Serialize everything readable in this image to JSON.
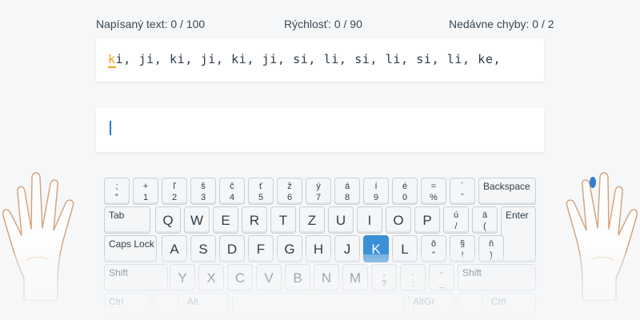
{
  "stats": {
    "typed": "Napísaný text: 0 / 100",
    "speed": "Rýchlosť: 0 / 90",
    "errors": "Nedávne chyby: 0 / 2"
  },
  "exercise": {
    "current_char": "k",
    "remaining_text": "i, ji, ki, ji, ki, ji, si, li, si, li, si, li, ke,"
  },
  "input": {
    "value": ""
  },
  "keyboard": {
    "rows": [
      [
        {
          "u": ";",
          "l": "°"
        },
        {
          "u": "+",
          "l": "1"
        },
        {
          "u": "ľ",
          "l": "2"
        },
        {
          "u": "š",
          "l": "3"
        },
        {
          "u": "č",
          "l": "4"
        },
        {
          "u": "ť",
          "l": "5"
        },
        {
          "u": "ž",
          "l": "6"
        },
        {
          "u": "ý",
          "l": "7"
        },
        {
          "u": "á",
          "l": "8"
        },
        {
          "u": "í",
          "l": "9"
        },
        {
          "u": "é",
          "l": "0"
        },
        {
          "u": "=",
          "l": "%"
        },
        {
          "u": "´",
          "l": "ˇ"
        },
        {
          "w": "Backspace"
        }
      ],
      [
        {
          "w": "Tab"
        },
        {
          "c": "Q"
        },
        {
          "c": "W"
        },
        {
          "c": "E"
        },
        {
          "c": "R"
        },
        {
          "c": "T"
        },
        {
          "c": "Z"
        },
        {
          "c": "U"
        },
        {
          "c": "I"
        },
        {
          "c": "O"
        },
        {
          "c": "P"
        },
        {
          "u": "ú",
          "l": "/"
        },
        {
          "u": "ä",
          "l": "("
        },
        {
          "w": "Enter"
        }
      ],
      [
        {
          "w": "Caps Lock"
        },
        {
          "c": "A"
        },
        {
          "c": "S"
        },
        {
          "c": "D"
        },
        {
          "c": "F"
        },
        {
          "c": "G"
        },
        {
          "c": "H"
        },
        {
          "c": "J"
        },
        {
          "c": "K"
        },
        {
          "c": "L"
        },
        {
          "u": "ô",
          "l": "\""
        },
        {
          "u": "§",
          "l": "!"
        },
        {
          "u": "ň",
          "l": ")"
        }
      ],
      [
        {
          "w": "Shift"
        },
        {
          "c": "Y"
        },
        {
          "c": "X"
        },
        {
          "c": "C"
        },
        {
          "c": "V"
        },
        {
          "c": "B"
        },
        {
          "c": "N"
        },
        {
          "c": "M"
        },
        {
          "u": ",",
          "l": "?"
        },
        {
          "u": ".",
          "l": ":"
        },
        {
          "u": "-",
          "l": "_"
        },
        {
          "w": "Shift"
        }
      ],
      [
        {
          "w": "Ctrl"
        },
        {
          "w": ""
        },
        {
          "w": "Alt"
        },
        {
          "w": ""
        },
        {
          "w": "AltGr"
        },
        {
          "w": ""
        },
        {
          "w": "Ctrl"
        }
      ]
    ],
    "active_key": "K"
  },
  "colors": {
    "accent": "#3b8fd6",
    "cursor_char": "#f0a01e",
    "caret": "#1d7ad6",
    "finger_marker": "#2e7fd1"
  },
  "hands": {
    "left": "left-hand-icon",
    "right": "right-hand-icon",
    "highlighted_finger": "right-middle"
  }
}
